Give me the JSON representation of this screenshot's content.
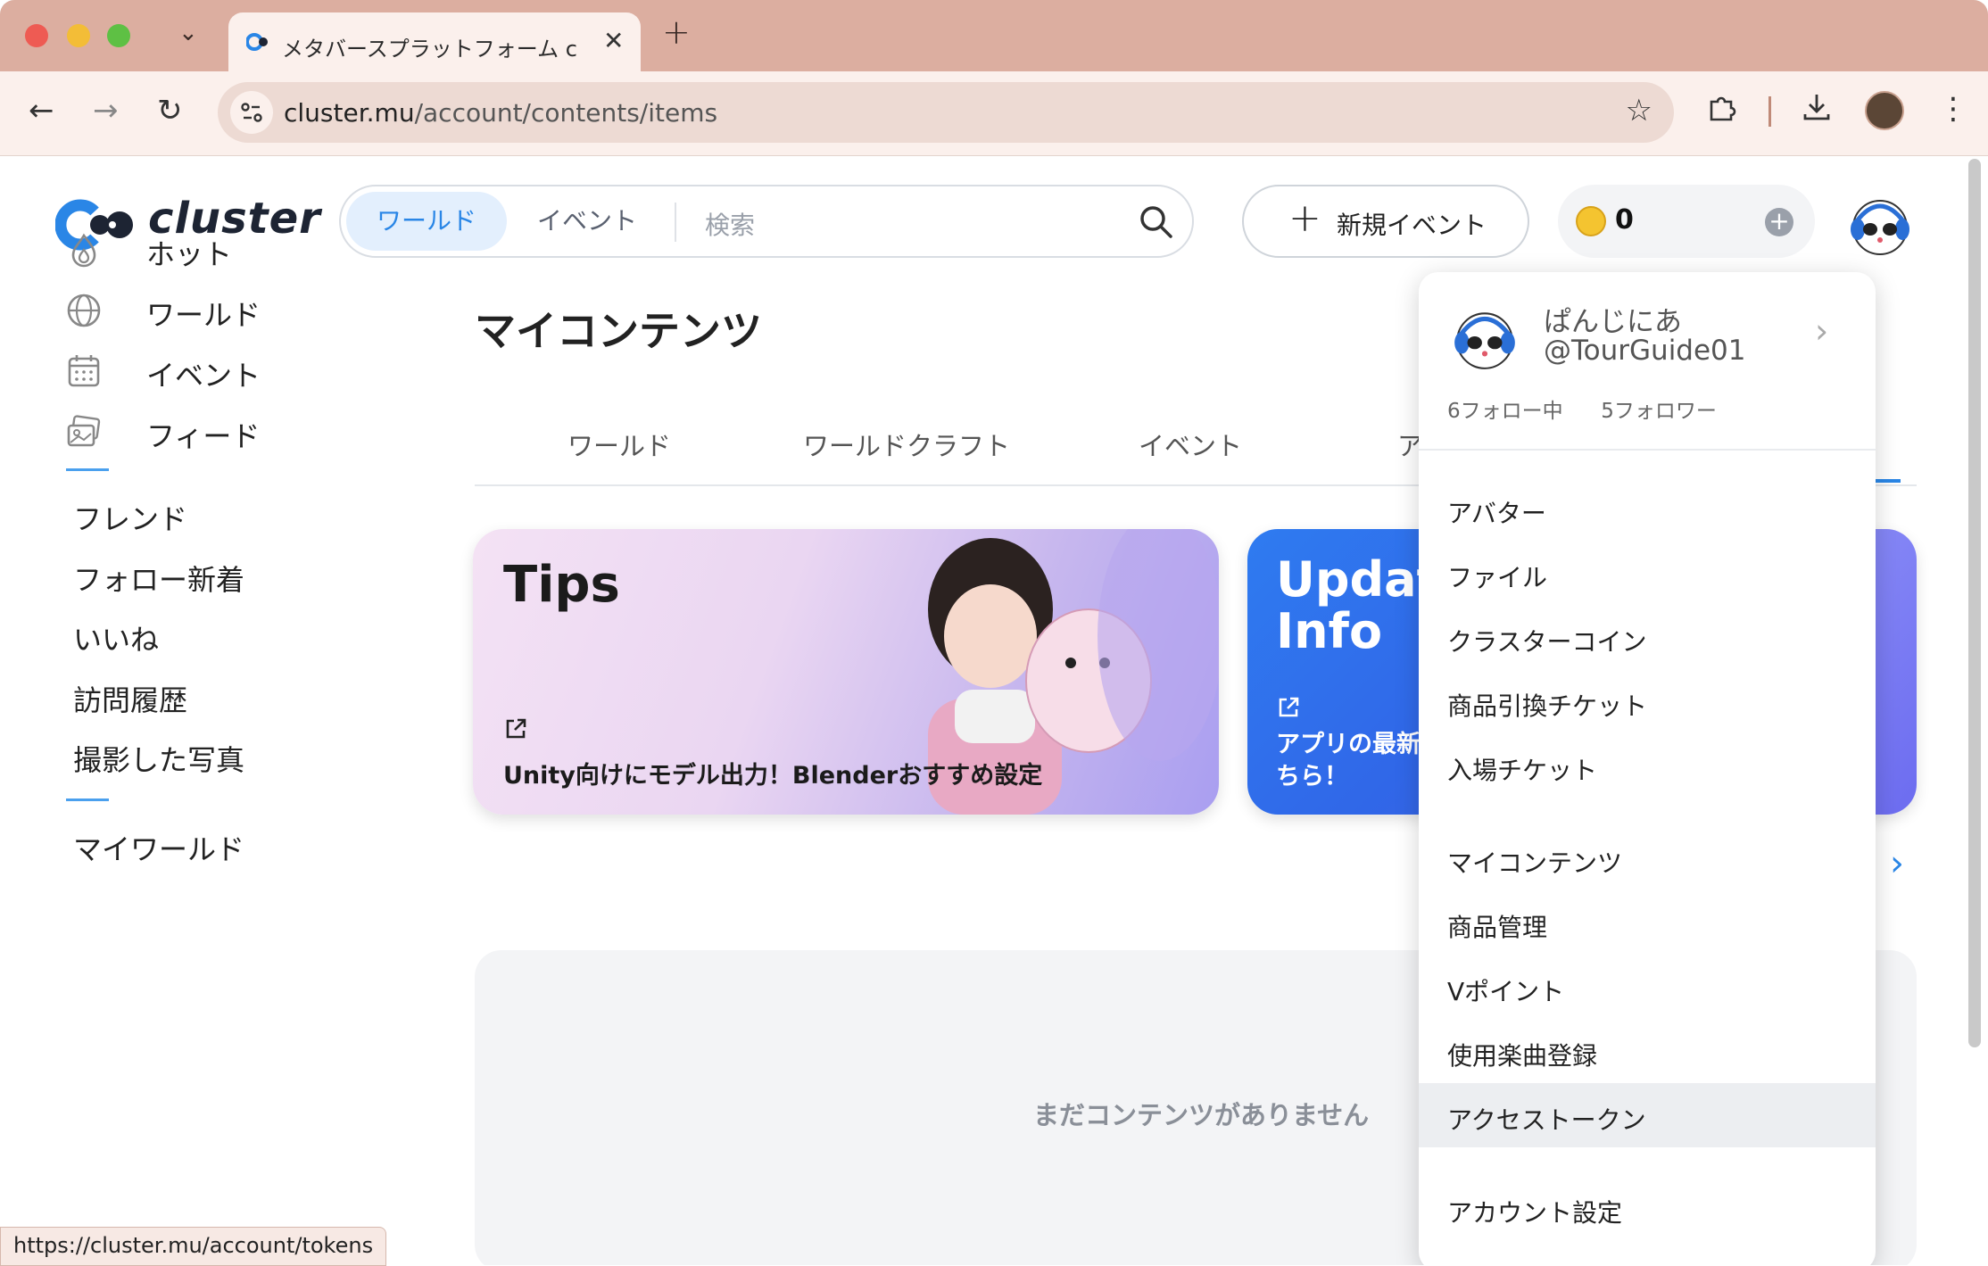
{
  "browser": {
    "tab_title": "メタバースプラットフォーム cluster",
    "new_tab_label": "+",
    "url_host": "cluster.mu",
    "url_path": "/account/contents/items"
  },
  "header": {
    "logo_text": "cluster",
    "search_tabs": [
      "ワールド",
      "イベント"
    ],
    "search_placeholder": "検索",
    "new_event_label": "新規イベント",
    "coin_count": "0"
  },
  "sidebar": {
    "primary": [
      {
        "label": "ホット",
        "icon": "flame-icon"
      },
      {
        "label": "ワールド",
        "icon": "globe-icon"
      },
      {
        "label": "イベント",
        "icon": "calendar-icon"
      },
      {
        "label": "フィード",
        "icon": "feed-icon"
      }
    ],
    "links": [
      "フレンド",
      "フォロー新着",
      "いいね",
      "訪問履歴",
      "撮影した写真"
    ],
    "section2": [
      "マイワールド"
    ]
  },
  "main": {
    "title": "マイコンテンツ",
    "tabs": [
      "ワールド",
      "ワールドクラフト",
      "イベント",
      "ア"
    ],
    "banners": [
      {
        "title": "Tips",
        "desc": "Unity向けにモデル出力！Blenderおすすめ設定"
      },
      {
        "title_line1": "Updat",
        "title_line2": "Info",
        "desc_line1": "アプリの最新",
        "desc_line2": "ちら！"
      }
    ],
    "empty_text": "まだコンテンツがありません"
  },
  "dropdown": {
    "name": "ぱんじにあ",
    "handle": "@TourGuide01",
    "following": "6フォロー中",
    "followers": "5フォロワー",
    "group1": [
      "アバター",
      "ファイル",
      "クラスターコイン",
      "商品引換チケット",
      "入場チケット"
    ],
    "group2": [
      "マイコンテンツ",
      "商品管理",
      "Vポイント",
      "使用楽曲登録",
      "アクセストークン"
    ],
    "group3": [
      "アカウント設定"
    ]
  },
  "status_url": "https://cluster.mu/account/tokens",
  "colors": {
    "accent": "#2a86e6",
    "tab_bar": "#dcaea0",
    "toolbar": "#fbf0ec"
  }
}
